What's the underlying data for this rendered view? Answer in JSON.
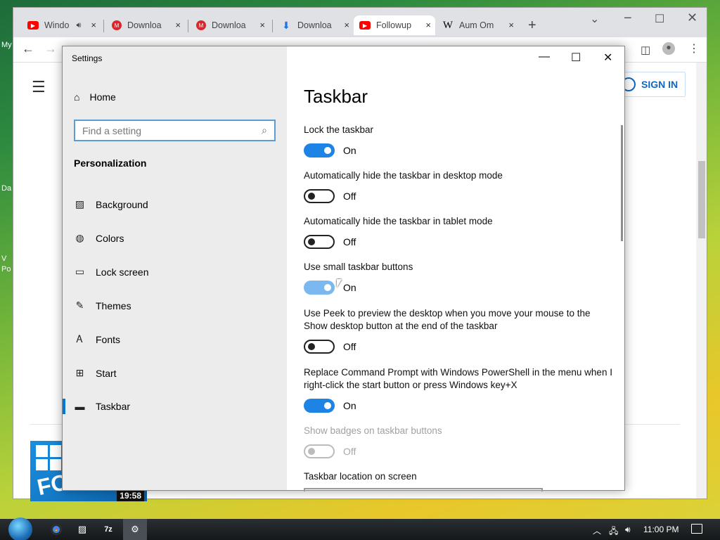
{
  "desktop": {
    "labels": [
      "My",
      "Da",
      "V",
      "Po"
    ]
  },
  "browser": {
    "tabs": [
      {
        "title": "Windo",
        "icon": "youtube-icon",
        "color": "#ff0000",
        "audio": true
      },
      {
        "title": "Downloa",
        "icon": "mega-icon",
        "color": "#d9272e"
      },
      {
        "title": "Downloa",
        "icon": "mega-icon",
        "color": "#d9272e"
      },
      {
        "title": "Downloa",
        "icon": "download-icon",
        "color": "#1a73e8"
      },
      {
        "title": "Followup",
        "icon": "youtube-icon",
        "color": "#ff0000",
        "active": true
      },
      {
        "title": "Aum Om",
        "icon": "wikipedia-icon",
        "color": "#000000"
      }
    ],
    "new_tab": "+",
    "close": "×",
    "sign_in": "SIGN IN",
    "video_duration": "19:58",
    "thumbnail_text": "FO"
  },
  "settings": {
    "window_title": "Settings",
    "home": "Home",
    "search_placeholder": "Find a setting",
    "section": "Personalization",
    "nav": [
      "Background",
      "Colors",
      "Lock screen",
      "Themes",
      "Fonts",
      "Start",
      "Taskbar"
    ],
    "active_nav": "Taskbar",
    "page_title": "Taskbar",
    "options": [
      {
        "label": "Lock the taskbar",
        "state": "On"
      },
      {
        "label": "Automatically hide the taskbar in desktop mode",
        "state": "Off"
      },
      {
        "label": "Automatically hide the taskbar in tablet mode",
        "state": "Off"
      },
      {
        "label": "Use small taskbar buttons",
        "state": "On"
      },
      {
        "label": "Use Peek to preview the desktop when you move your mouse to the Show desktop button at the end of the taskbar",
        "state": "Off"
      },
      {
        "label": "Replace Command Prompt with Windows PowerShell in the menu when I right-click the start button or press Windows key+X",
        "state": "On"
      },
      {
        "label": "Show badges on taskbar buttons",
        "state": "Off",
        "disabled": true
      }
    ],
    "location_label": "Taskbar location on screen"
  },
  "taskbar": {
    "time": "11:00 PM",
    "accent": "#0078d7"
  }
}
